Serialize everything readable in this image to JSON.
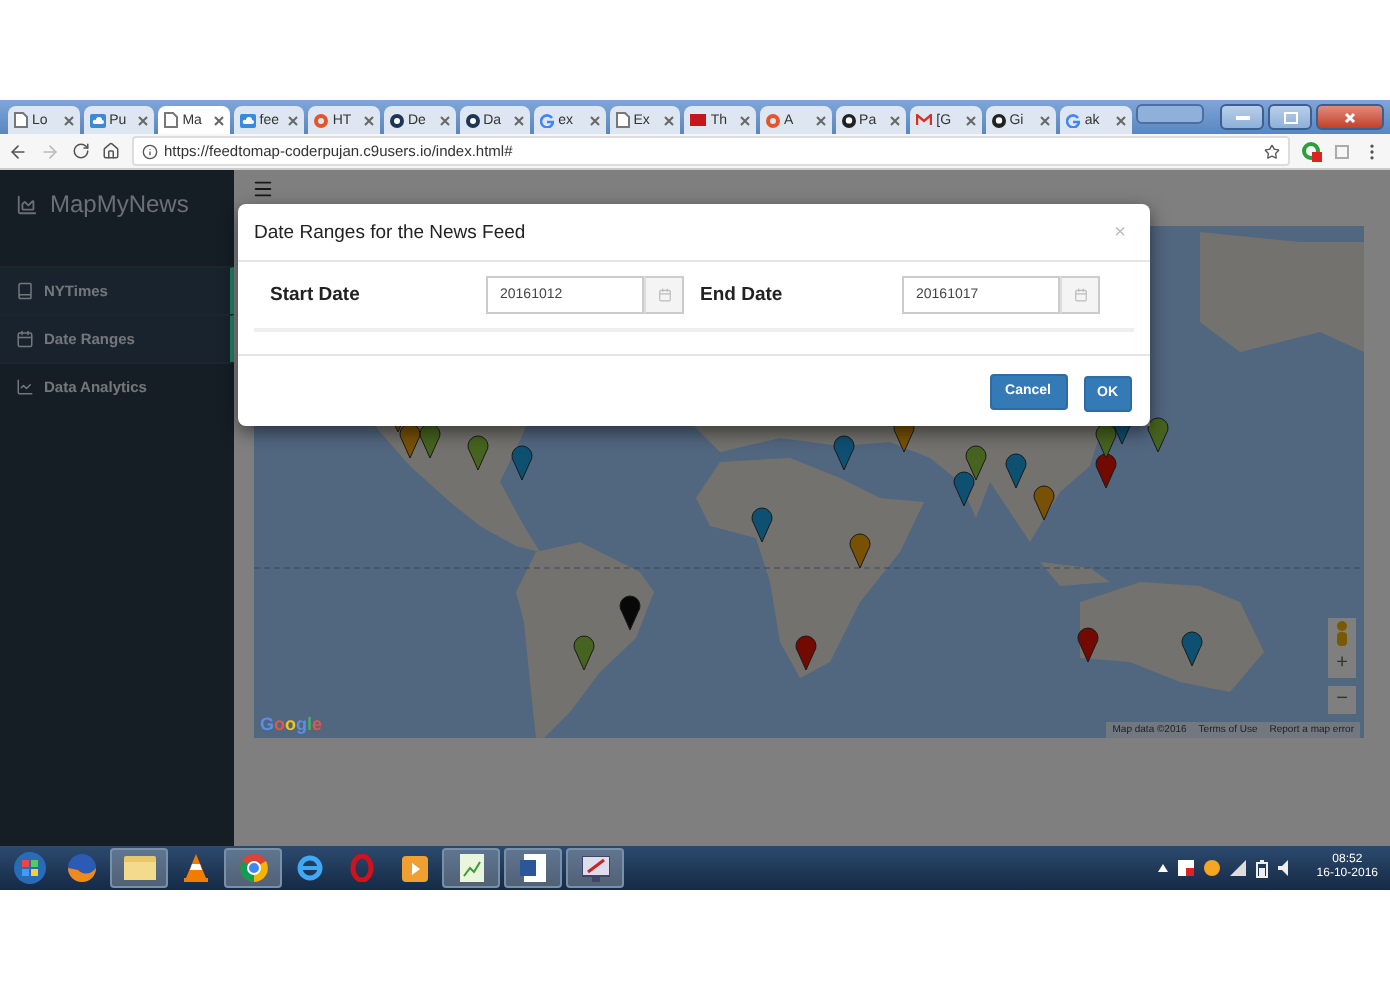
{
  "browser": {
    "tabs": [
      {
        "label": "Lo",
        "kind": "page",
        "selected": false
      },
      {
        "label": "Pu",
        "kind": "cloud",
        "selected": false
      },
      {
        "label": "Ma",
        "kind": "page",
        "selected": true
      },
      {
        "label": "fee",
        "kind": "cloud",
        "selected": false
      },
      {
        "label": "HT",
        "kind": "ring",
        "selected": false
      },
      {
        "label": "De",
        "kind": "disc",
        "selected": false
      },
      {
        "label": "Da",
        "kind": "disc",
        "selected": false
      },
      {
        "label": "ex",
        "kind": "g",
        "selected": false
      },
      {
        "label": "Ex",
        "kind": "page",
        "selected": false
      },
      {
        "label": "Th",
        "kind": "badge",
        "selected": false
      },
      {
        "label": "A",
        "kind": "ring",
        "selected": false
      },
      {
        "label": "Pa",
        "kind": "cat",
        "selected": false
      },
      {
        "label": "[G",
        "kind": "mail",
        "selected": false
      },
      {
        "label": "Gi",
        "kind": "cat",
        "selected": false
      },
      {
        "label": "ak",
        "kind": "g",
        "selected": false
      }
    ],
    "url": "https://feedtomap-coderpujan.c9users.io/index.html#"
  },
  "sidebar": {
    "brand": "MapMyNews",
    "items": [
      {
        "label": "NYTimes",
        "highlighted": true
      },
      {
        "label": "Date Ranges",
        "highlighted": true
      },
      {
        "label": "Data Analytics",
        "highlighted": false
      }
    ]
  },
  "map": {
    "logo": "Google",
    "attribution": [
      "Map data ©2016",
      "Terms of Use",
      "Report a map error"
    ],
    "zoom_in": "+",
    "zoom_out": "−"
  },
  "dialog": {
    "title": "Date Ranges for the News Feed",
    "close": "×",
    "fields": [
      {
        "label": "Start Date",
        "value": "20161012"
      },
      {
        "label": "End Date",
        "value": "20161017"
      }
    ],
    "buttons": [
      {
        "label": "Cancel",
        "kind": "secondary"
      },
      {
        "label": "OK",
        "kind": "primary"
      }
    ]
  },
  "taskbar": {
    "time": "08:52",
    "date": "16-10-2016"
  }
}
